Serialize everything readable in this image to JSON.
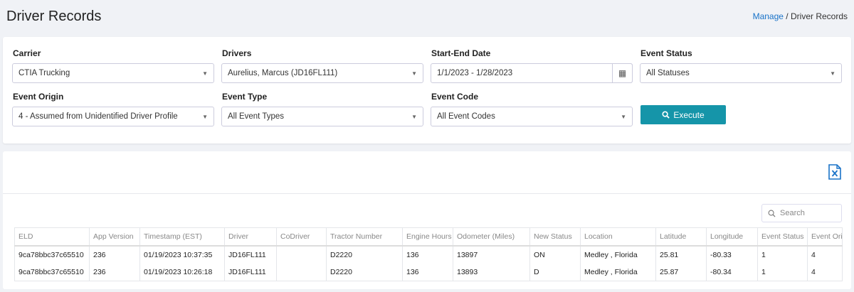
{
  "header": {
    "title": "Driver Records",
    "breadcrumb": {
      "link": "Manage",
      "sep": "/",
      "current": "Driver Records"
    }
  },
  "filters": {
    "carrier": {
      "label": "Carrier",
      "value": "CTIA Trucking"
    },
    "drivers": {
      "label": "Drivers",
      "value": "Aurelius, Marcus (JD16FL111)"
    },
    "date": {
      "label": "Start-End Date",
      "value": "1/1/2023 - 1/28/2023"
    },
    "event_status": {
      "label": "Event Status",
      "value": "All Statuses"
    },
    "event_origin": {
      "label": "Event Origin",
      "value": "4 - Assumed from Unidentified Driver Profile"
    },
    "event_type": {
      "label": "Event Type",
      "value": "All Event Types"
    },
    "event_code": {
      "label": "Event Code",
      "value": "All Event Codes"
    },
    "execute_label": "Execute"
  },
  "search": {
    "placeholder": "Search"
  },
  "table": {
    "columns": [
      "ELD",
      "App Version",
      "Timestamp (EST)",
      "Driver",
      "CoDriver",
      "Tractor Number",
      "Engine Hours",
      "Odometer (Miles)",
      "New Status",
      "Location",
      "Latitude",
      "Longitude",
      "Event Status",
      "Event Orig"
    ],
    "rows": [
      [
        "9ca78bbc37c65510",
        "236",
        "01/19/2023 10:37:35",
        "JD16FL111",
        "",
        "D2220",
        "136",
        "13897",
        "ON",
        "Medley , Florida",
        "25.81",
        "-80.33",
        "1",
        "4"
      ],
      [
        "9ca78bbc37c65510",
        "236",
        "01/19/2023 10:26:18",
        "JD16FL111",
        "",
        "D2220",
        "136",
        "13893",
        "D",
        "Medley , Florida",
        "25.87",
        "-80.34",
        "1",
        "4"
      ]
    ]
  }
}
